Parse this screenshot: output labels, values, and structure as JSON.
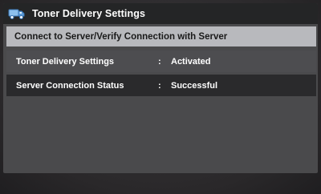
{
  "titlebar": {
    "icon": "delivery-truck-icon",
    "title": "Toner Delivery Settings"
  },
  "header": {
    "label": "Connect to Server/Verify Connection with Server"
  },
  "rows": [
    {
      "label": "Toner Delivery Settings",
      "separator": ":",
      "value": "Activated"
    },
    {
      "label": "Server Connection Status",
      "separator": ":",
      "value": "Successful"
    }
  ],
  "colors": {
    "titlebar": "#242526",
    "header_row": "#b8b9bd",
    "row_normal": "#4d4d50",
    "row_selected": "#2a2a2c",
    "icon_blue": "#5a9bd8"
  }
}
